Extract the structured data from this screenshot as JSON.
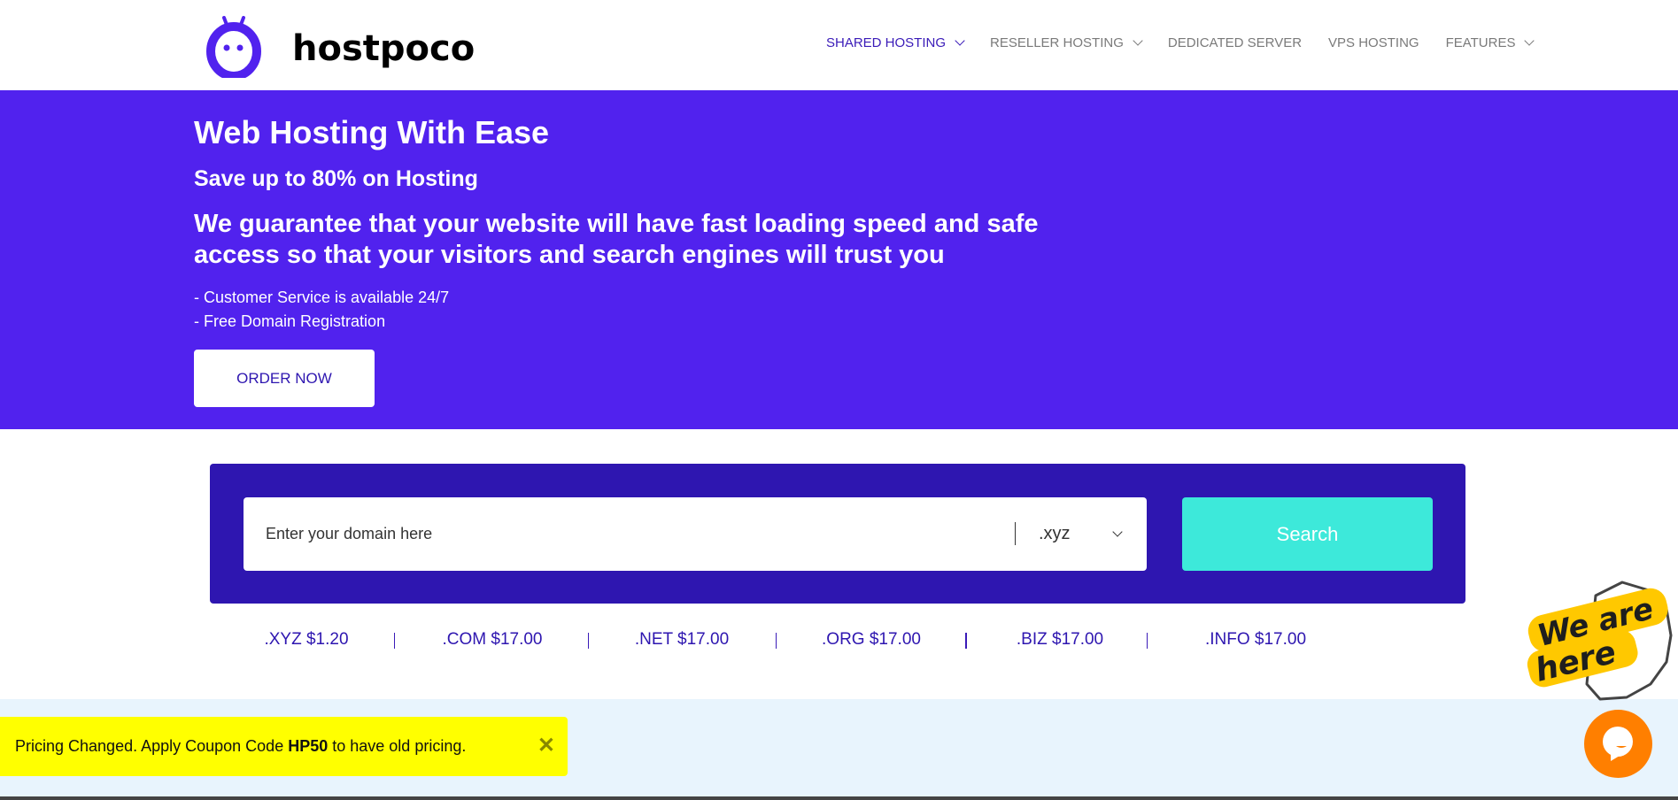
{
  "header": {
    "brand": "hostpoco",
    "brand_color": "#5122EE",
    "nav": [
      {
        "label": "SHARED HOSTING",
        "dropdown": true,
        "active": true
      },
      {
        "label": "RESELLER HOSTING",
        "dropdown": true
      },
      {
        "label": "DEDICATED SERVER",
        "dropdown": false
      },
      {
        "label": "VPS HOSTING",
        "dropdown": false
      },
      {
        "label": "FEATURES",
        "dropdown": true
      }
    ]
  },
  "hero": {
    "title": "Web Hosting With Ease",
    "subtitle": "Save up to 80% on Hosting",
    "tagline": "We guarantee that your website will have fast loading speed and safe access so that your visitors and search engines will trust you",
    "bullets": [
      "- Customer Service is available 24/7",
      "- Free Domain Registration"
    ],
    "cta": "ORDER NOW"
  },
  "domain_search": {
    "placeholder": "Enter your domain here",
    "tld": ".xyz",
    "button": "Search",
    "button_color": "#3DE9DA"
  },
  "prices": [
    ".XYZ $1.20",
    ".COM $17.00",
    ".NET $17.00",
    ".ORG $17.00",
    ".BIZ $17.00",
    ".INFO $17.00"
  ],
  "banner": {
    "pre": "Pricing Changed. Apply Coupon Code ",
    "code": "HP50",
    "post": " to have old pricing.",
    "close": "✕"
  },
  "badge": {
    "text": "We are here"
  },
  "chat": {
    "icon": "chat-bubble-icon"
  }
}
